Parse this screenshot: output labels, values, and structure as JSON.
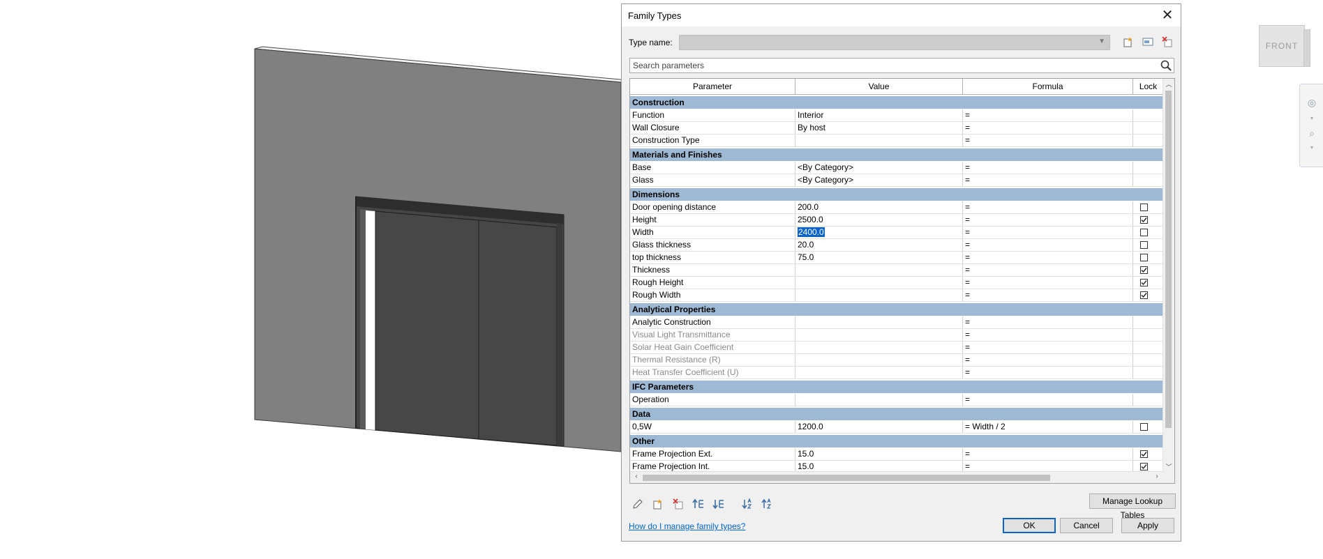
{
  "viewcube": {
    "face": "FRONT",
    "side": "LEFT"
  },
  "dialog": {
    "title": "Family Types",
    "close_glyph": "✕",
    "type_name_label": "Type name:",
    "type_name_value": "",
    "search_placeholder": "Search parameters",
    "columns": [
      "Parameter",
      "Value",
      "Formula",
      "Lock"
    ],
    "sections": [
      {
        "title": "Construction",
        "rows": [
          {
            "param": "Function",
            "value": "Interior",
            "formula": "=",
            "lock": null
          },
          {
            "param": "Wall Closure",
            "value": "By host",
            "formula": "=",
            "lock": null
          },
          {
            "param": "Construction Type",
            "value": "",
            "formula": "=",
            "lock": null
          }
        ]
      },
      {
        "title": "Materials and Finishes",
        "rows": [
          {
            "param": "Base",
            "value": "<By Category>",
            "formula": "=",
            "lock": null
          },
          {
            "param": "Glass",
            "value": "<By Category>",
            "formula": "=",
            "lock": null
          }
        ]
      },
      {
        "title": "Dimensions",
        "rows": [
          {
            "param": "Door opening distance",
            "value": "200.0",
            "formula": "=",
            "lock": false
          },
          {
            "param": "Height",
            "value": "2500.0",
            "formula": "=",
            "lock": true
          },
          {
            "param": "Width",
            "value": "2400.0",
            "formula": "=",
            "lock": false,
            "selected": true
          },
          {
            "param": "Glass thickness",
            "value": "20.0",
            "formula": "=",
            "lock": false
          },
          {
            "param": "top thickness",
            "value": "75.0",
            "formula": "=",
            "lock": false
          },
          {
            "param": "Thickness",
            "value": "",
            "formula": "=",
            "lock": true
          },
          {
            "param": "Rough Height",
            "value": "",
            "formula": "=",
            "lock": true
          },
          {
            "param": "Rough Width",
            "value": "",
            "formula": "=",
            "lock": true
          }
        ]
      },
      {
        "title": "Analytical Properties",
        "rows": [
          {
            "param": "Analytic Construction",
            "value": "",
            "formula": "=",
            "lock": null
          },
          {
            "param": "Visual Light Transmittance",
            "value": "",
            "formula": "=",
            "lock": null,
            "disabled": true
          },
          {
            "param": "Solar Heat Gain Coefficient",
            "value": "",
            "formula": "=",
            "lock": null,
            "disabled": true
          },
          {
            "param": "Thermal Resistance (R)",
            "value": "",
            "formula": "=",
            "lock": null,
            "disabled": true
          },
          {
            "param": "Heat Transfer Coefficient (U)",
            "value": "",
            "formula": "=",
            "lock": null,
            "disabled": true
          }
        ]
      },
      {
        "title": "IFC Parameters",
        "rows": [
          {
            "param": "Operation",
            "value": "",
            "formula": "=",
            "lock": null
          }
        ]
      },
      {
        "title": "Data",
        "rows": [
          {
            "param": "0,5W",
            "value": "1200.0",
            "formula": "= Width / 2",
            "lock": false
          }
        ]
      },
      {
        "title": "Other",
        "rows": [
          {
            "param": "Frame Projection Ext.",
            "value": "15.0",
            "formula": "=",
            "lock": true
          },
          {
            "param": "Frame Projection Int.",
            "value": "15.0",
            "formula": "=",
            "lock": true
          }
        ]
      }
    ],
    "manage_lookup_label": "Manage Lookup Tables",
    "help_link": "How do I manage family types?",
    "ok_label": "OK",
    "cancel_label": "Cancel",
    "apply_label": "Apply"
  },
  "colors": {
    "section_header": "#9eb9d3",
    "selection": "#0a64c8",
    "link": "#0066cc"
  }
}
